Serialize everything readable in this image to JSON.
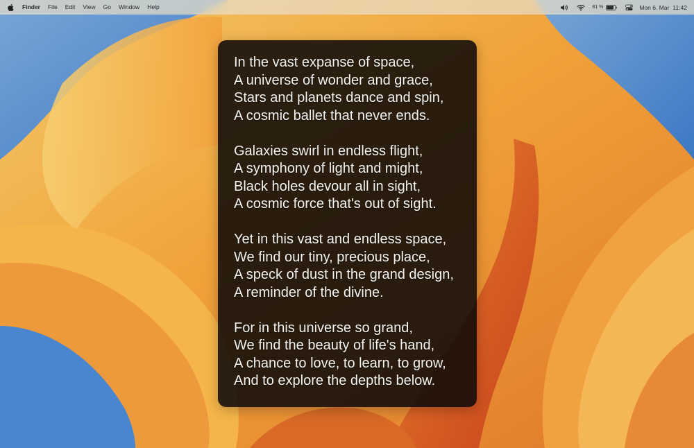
{
  "menubar": {
    "app_name": "Finder",
    "menus": [
      "File",
      "Edit",
      "View",
      "Go",
      "Window",
      "Help"
    ],
    "battery_percent": "81 %",
    "date": "Mon 6. Mar",
    "time": "11:42"
  },
  "poem": {
    "stanzas": [
      [
        "In the vast expanse of space,",
        "A universe of wonder and grace,",
        "Stars and planets dance and spin,",
        "A cosmic ballet that never ends."
      ],
      [
        "Galaxies swirl in endless flight,",
        "A symphony of light and might,",
        "Black holes devour all in sight,",
        "A cosmic force that's out of sight."
      ],
      [
        "Yet in this vast and endless space,",
        "We find our tiny, precious place,",
        "A speck of dust in the grand design,",
        "A reminder of the divine."
      ],
      [
        "For in this universe so grand,",
        "We find the beauty of life's hand,",
        "A chance to love, to learn, to grow,",
        "And to explore the depths below."
      ]
    ]
  },
  "colors": {
    "wallpaper_orange": "#f0a030",
    "wallpaper_deep": "#d2581e",
    "wallpaper_blue": "#3f7fc8",
    "panel_bg": "#0e0a08"
  }
}
